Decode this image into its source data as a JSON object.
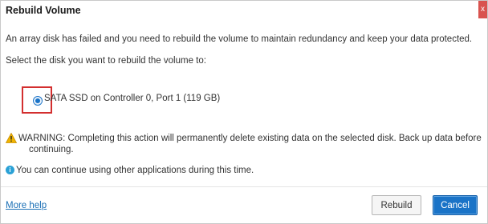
{
  "dialog": {
    "title": "Rebuild Volume",
    "close_label": "x",
    "message": "An array disk has failed and you need to rebuild the volume to maintain redundancy and keep your data protected.",
    "prompt": "Select the disk you want to rebuild the volume to:",
    "disk_option": {
      "label": "SATA SSD on Controller 0, Port 1 (119 GB)",
      "selected": true
    },
    "warning_line1": "WARNING: Completing this action will permanently delete existing data on the selected disk. Back up data before",
    "warning_line2": "continuing.",
    "info": "You can continue using other applications during this time.",
    "more_help": "More help",
    "buttons": {
      "rebuild": "Rebuild",
      "cancel": "Cancel"
    },
    "colors": {
      "accent": "#1a73c7",
      "highlight_box": "#d32f2f",
      "warning": "#f0b400",
      "info": "#2aa1d6",
      "close": "#d9534f"
    },
    "icons": {
      "warning": "warning-triangle-icon",
      "info": "info-icon"
    }
  }
}
